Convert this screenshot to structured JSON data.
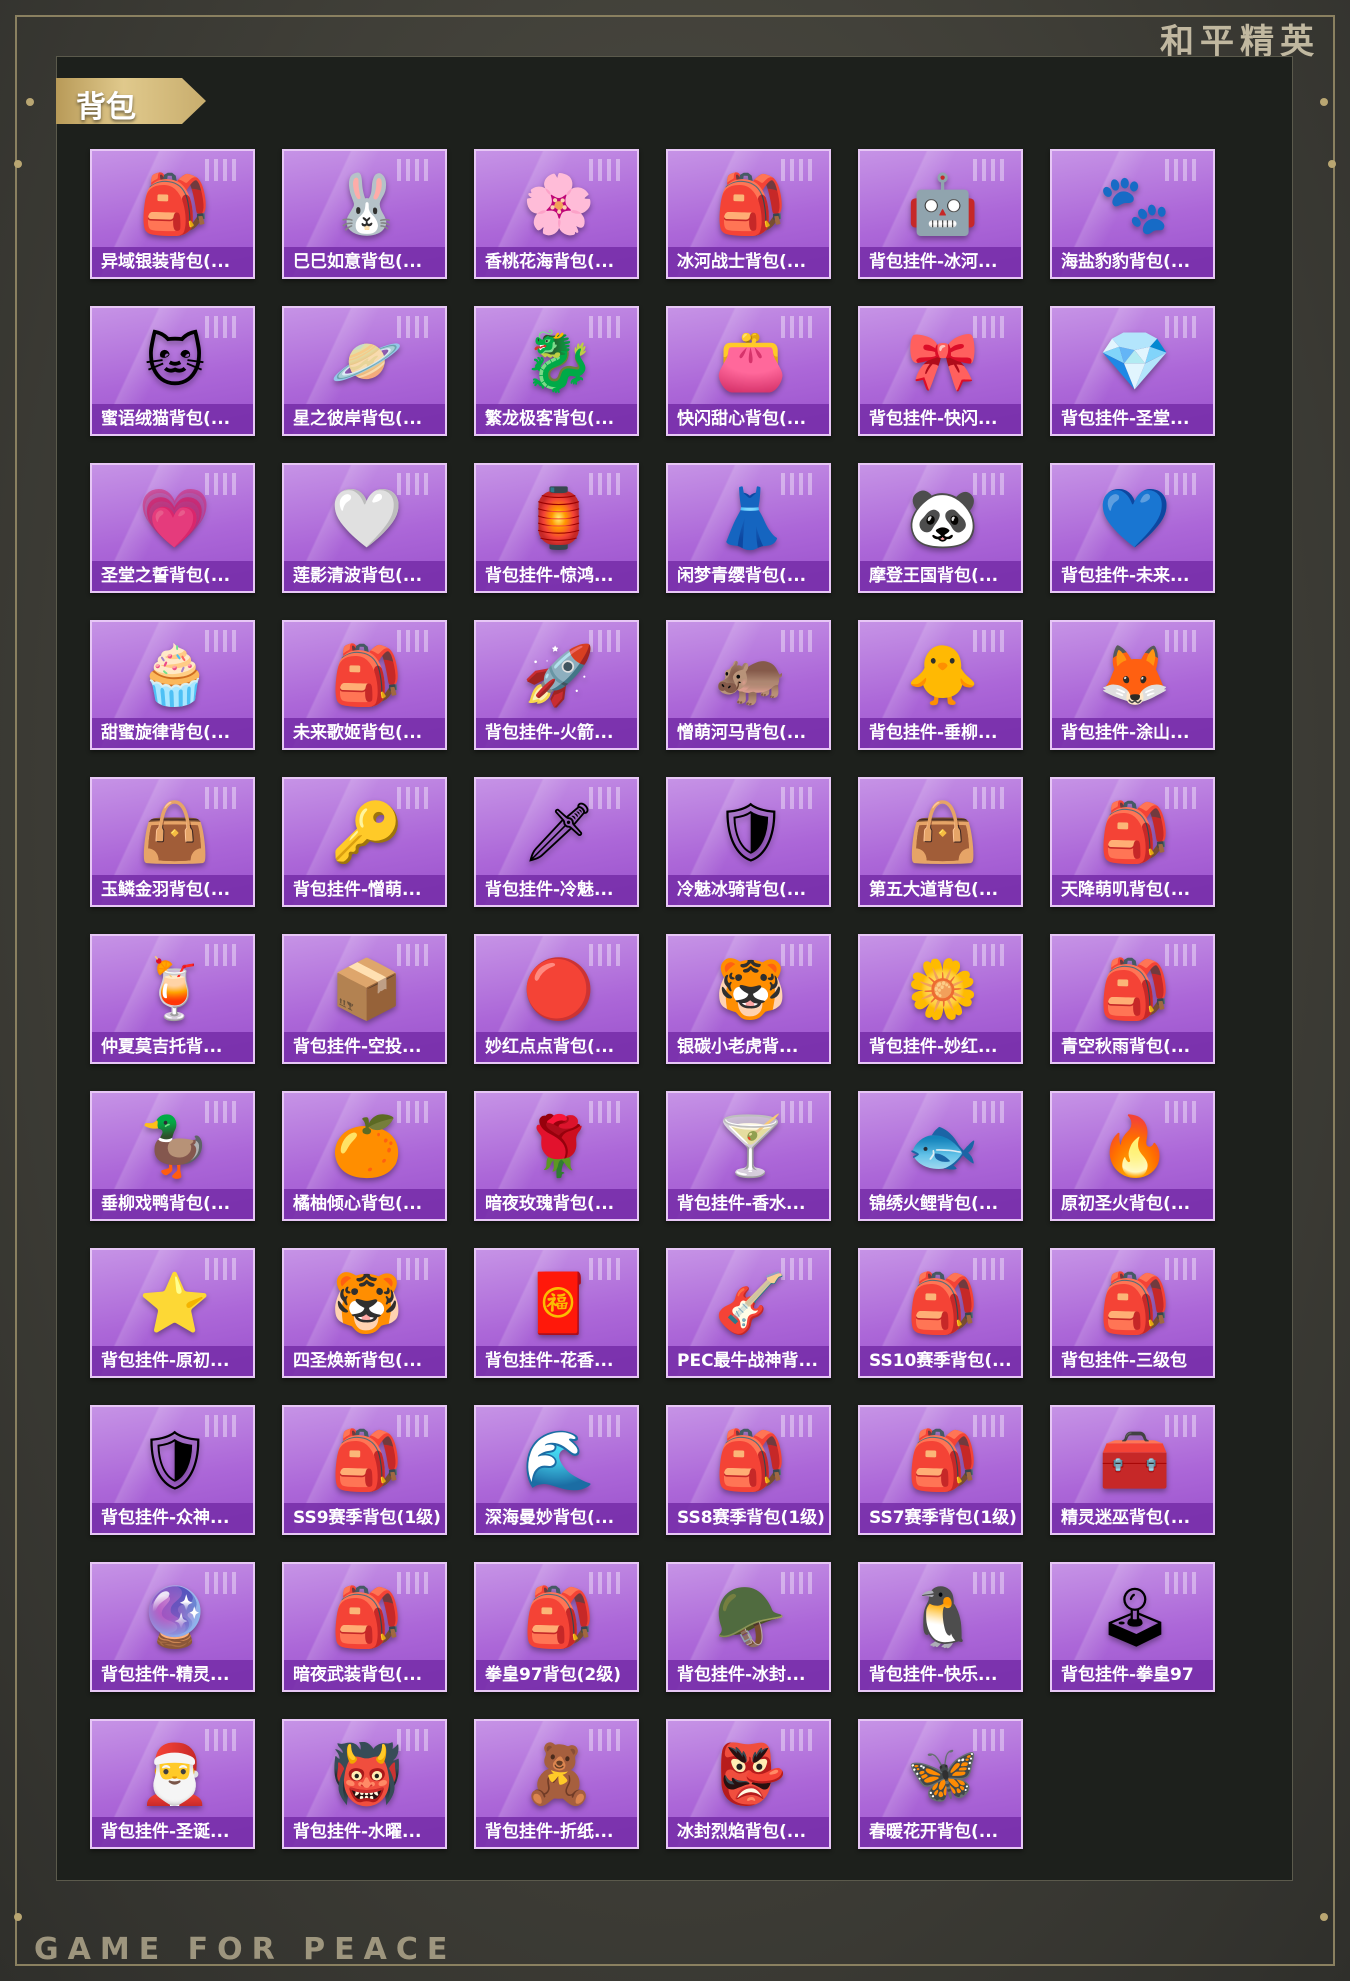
{
  "brand": "和平精英",
  "footer": "GAME FOR PEACE",
  "section_title": "背包",
  "items": [
    {
      "label": "异域银装背包(...",
      "icon": "🎒"
    },
    {
      "label": "巳巳如意背包(...",
      "icon": "🐰"
    },
    {
      "label": "香桃花海背包(...",
      "icon": "🌸"
    },
    {
      "label": "冰河战士背包(...",
      "icon": "🎒"
    },
    {
      "label": "背包挂件-冰河...",
      "icon": "🤖"
    },
    {
      "label": "海盐豹豹背包(...",
      "icon": "🐾"
    },
    {
      "label": "蜜语绒猫背包(...",
      "icon": "🐱"
    },
    {
      "label": "星之彼岸背包(...",
      "icon": "🪐"
    },
    {
      "label": "繁龙极客背包(...",
      "icon": "🐉"
    },
    {
      "label": "快闪甜心背包(...",
      "icon": "👛"
    },
    {
      "label": "背包挂件-快闪...",
      "icon": "🎀"
    },
    {
      "label": "背包挂件-圣堂...",
      "icon": "💎"
    },
    {
      "label": "圣堂之誓背包(...",
      "icon": "💗"
    },
    {
      "label": "莲影清波背包(...",
      "icon": "🤍"
    },
    {
      "label": "背包挂件-惊鸿...",
      "icon": "🏮"
    },
    {
      "label": "闲梦青缨背包(...",
      "icon": "👗"
    },
    {
      "label": "摩登王国背包(...",
      "icon": "🐼"
    },
    {
      "label": "背包挂件-未来...",
      "icon": "💙"
    },
    {
      "label": "甜蜜旋律背包(...",
      "icon": "🧁"
    },
    {
      "label": "未来歌姬背包(...",
      "icon": "🎒"
    },
    {
      "label": "背包挂件-火箭...",
      "icon": "🚀"
    },
    {
      "label": "憎萌河马背包(...",
      "icon": "🦛"
    },
    {
      "label": "背包挂件-垂柳...",
      "icon": "🐥"
    },
    {
      "label": "背包挂件-涂山...",
      "icon": "🦊"
    },
    {
      "label": "玉鳞金羽背包(...",
      "icon": "👜"
    },
    {
      "label": "背包挂件-憎萌...",
      "icon": "🔑"
    },
    {
      "label": "背包挂件-冷魅...",
      "icon": "🗡"
    },
    {
      "label": "冷魅冰骑背包(...",
      "icon": "🛡"
    },
    {
      "label": "第五大道背包(...",
      "icon": "👜"
    },
    {
      "label": "天降萌叽背包(...",
      "icon": "🎒"
    },
    {
      "label": "仲夏莫吉托背...",
      "icon": "🍹"
    },
    {
      "label": "背包挂件-空投...",
      "icon": "📦"
    },
    {
      "label": "妙红点点背包(...",
      "icon": "🔴"
    },
    {
      "label": "银碳小老虎背...",
      "icon": "🐯"
    },
    {
      "label": "背包挂件-妙红...",
      "icon": "🌼"
    },
    {
      "label": "青空秋雨背包(...",
      "icon": "🎒"
    },
    {
      "label": "垂柳戏鸭背包(...",
      "icon": "🦆"
    },
    {
      "label": "橘柚倾心背包(...",
      "icon": "🍊"
    },
    {
      "label": "暗夜玫瑰背包(...",
      "icon": "🌹"
    },
    {
      "label": "背包挂件-香水...",
      "icon": "🍸"
    },
    {
      "label": "锦绣火鲤背包(...",
      "icon": "🐟"
    },
    {
      "label": "原初圣火背包(...",
      "icon": "🔥"
    },
    {
      "label": "背包挂件-原初...",
      "icon": "⭐"
    },
    {
      "label": "四圣焕新背包(...",
      "icon": "🐯"
    },
    {
      "label": "背包挂件-花香...",
      "icon": "🧧"
    },
    {
      "label": "PEC最牛战神背...",
      "icon": "🎸"
    },
    {
      "label": "SS10赛季背包(...",
      "icon": "🎒"
    },
    {
      "label": "背包挂件-三级包",
      "icon": "🎒"
    },
    {
      "label": "背包挂件-众神...",
      "icon": "🛡"
    },
    {
      "label": "SS9赛季背包(1级)",
      "icon": "🎒"
    },
    {
      "label": "深海曼妙背包(...",
      "icon": "🌊"
    },
    {
      "label": "SS8赛季背包(1级)",
      "icon": "🎒"
    },
    {
      "label": "SS7赛季背包(1级)",
      "icon": "🎒"
    },
    {
      "label": "精灵迷巫背包(...",
      "icon": "🧰"
    },
    {
      "label": "背包挂件-精灵...",
      "icon": "🔮"
    },
    {
      "label": "暗夜武装背包(...",
      "icon": "🎒"
    },
    {
      "label": "拳皇97背包(2级)",
      "icon": "🎒"
    },
    {
      "label": "背包挂件-冰封...",
      "icon": "🪖"
    },
    {
      "label": "背包挂件-快乐...",
      "icon": "🐧"
    },
    {
      "label": "背包挂件-拳皇97",
      "icon": "🕹"
    },
    {
      "label": "背包挂件-圣诞...",
      "icon": "🎅"
    },
    {
      "label": "背包挂件-水曜...",
      "icon": "👹"
    },
    {
      "label": "背包挂件-折纸...",
      "icon": "🧸"
    },
    {
      "label": "冰封烈焰背包(...",
      "icon": "👺"
    },
    {
      "label": "春暖花开背包(...",
      "icon": "🦋"
    }
  ]
}
